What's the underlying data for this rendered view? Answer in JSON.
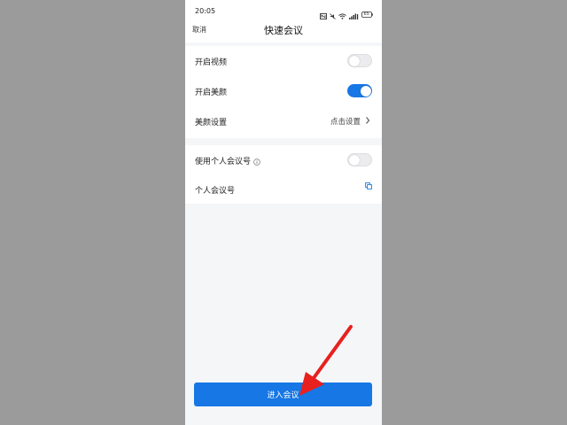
{
  "status_bar": {
    "time": "20:05",
    "battery": "65",
    "icons": [
      "nfc-icon",
      "mute-icon",
      "wifi-icon",
      "signal-icon",
      "battery-icon"
    ]
  },
  "header": {
    "cancel_label": "取消",
    "title": "快速会议"
  },
  "settings_group_1": {
    "enable_video": {
      "label": "开启视频",
      "checked": false
    },
    "enable_beauty": {
      "label": "开启美颜",
      "checked": true
    },
    "beauty_settings": {
      "label": "美颜设置",
      "value": "点击设置"
    }
  },
  "settings_group_2": {
    "use_personal_id": {
      "label": "使用个人会议号",
      "checked": false
    },
    "personal_id": {
      "label": "个人会议号"
    }
  },
  "footer": {
    "enter_label": "进入会议"
  },
  "colors": {
    "accent": "#1677e5",
    "annotation_arrow": "#e8201e",
    "backdrop": "#9b9b9b"
  }
}
